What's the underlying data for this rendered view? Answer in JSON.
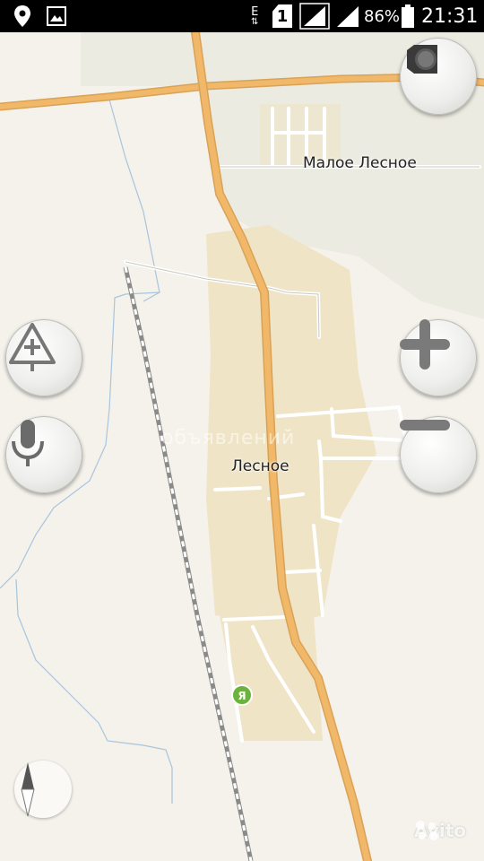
{
  "status_bar": {
    "network_type": "E",
    "sim_slot": "1",
    "battery_percent": "86%",
    "time": "21:31",
    "icons": [
      "location-icon",
      "image-icon",
      "data-transfer-icon",
      "sim-icon",
      "signal-icon",
      "signal-icon-2",
      "battery-icon"
    ]
  },
  "map": {
    "places": [
      {
        "name": "Малое Лесное"
      },
      {
        "name": "Лесное"
      }
    ],
    "marker_letter": "Я",
    "watermark": "объявлений"
  },
  "controls": {
    "traffic_button": "traffic-light-icon",
    "add_event_button": "warning-plus-icon",
    "voice_button": "microphone-icon",
    "zoom_in_button": "plus-icon",
    "zoom_out_button": "minus-icon",
    "compass": "compass-icon"
  },
  "branding": {
    "avito": "Avito"
  },
  "colors": {
    "road_major": "#f0b868",
    "road_minor": "#ffffff",
    "river": "#a8c4de",
    "settlement": "#efe4c6",
    "railway": "#888888"
  }
}
